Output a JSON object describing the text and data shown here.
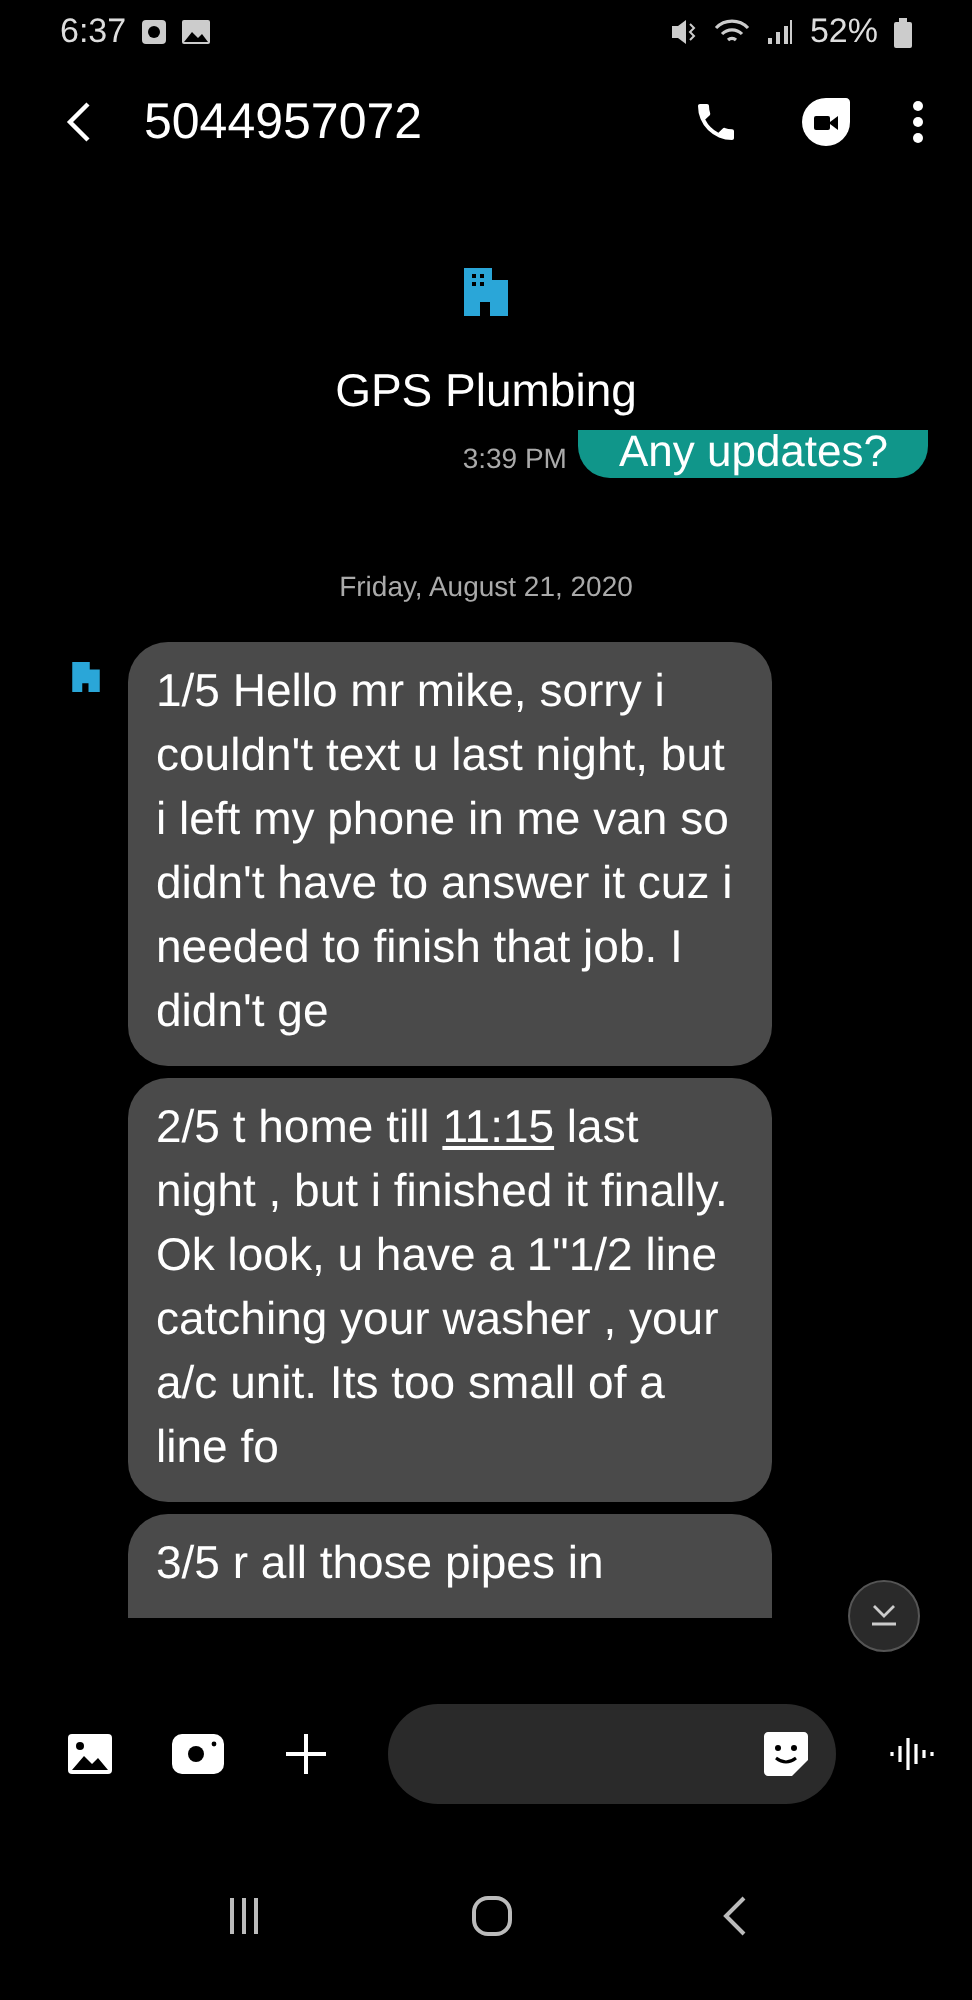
{
  "status_bar": {
    "time": "6:37",
    "battery": "52%"
  },
  "header": {
    "title": "5044957072"
  },
  "contact": {
    "name": "GPS Plumbing"
  },
  "sent": {
    "time": "3:39 PM",
    "text": "Any updates?"
  },
  "date_divider": "Friday, August 21, 2020",
  "messages": [
    {
      "segments": [
        {
          "text": "1/5 Hello mr mike, sorry i couldn't text u last night, but i left my phone in me van so didn't have to answer it cuz i needed to finish that job. I didn't ge",
          "link": false
        }
      ]
    },
    {
      "segments": [
        {
          "text": "2/5 t home till ",
          "link": false
        },
        {
          "text": "11:15",
          "link": true
        },
        {
          "text": " last night , but i finished it finally.  Ok look, u have a 1\"1/2 line catching your washer , your a/c unit.  Its too small of a line fo",
          "link": false
        }
      ]
    },
    {
      "segments": [
        {
          "text": "3/5 r all those pipes in",
          "link": false
        }
      ]
    }
  ]
}
